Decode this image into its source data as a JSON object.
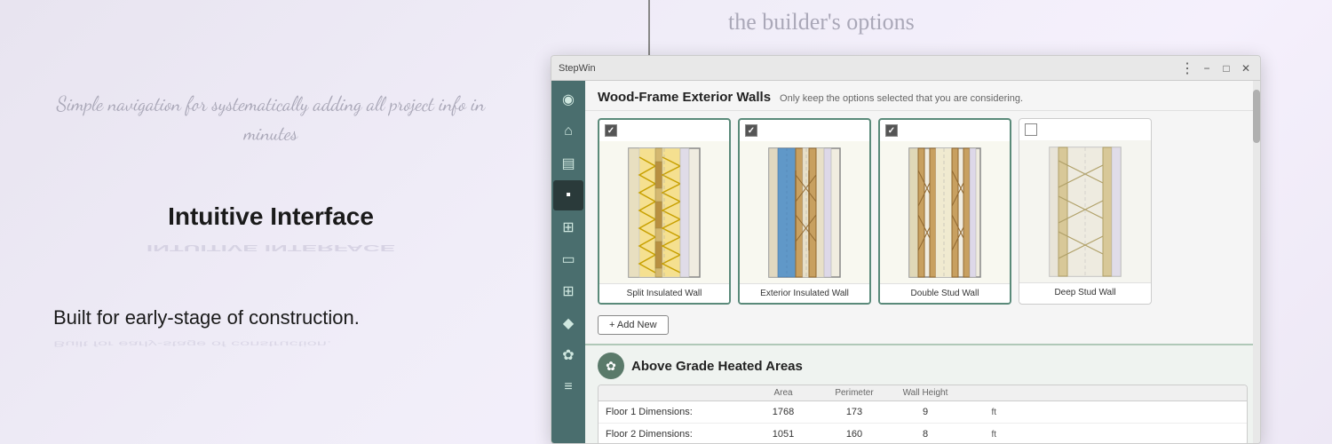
{
  "background": {
    "top_right_text": "the builder's options"
  },
  "left_panel": {
    "nav_text": "Simple navigation for\nsystematically adding all\nproject info in minutes",
    "intuitive_label": "Intuitive Interface",
    "intuitive_reflection": "INTUITIVE INTERFACE",
    "built_label": "Built for early-stage of construction.",
    "built_reflection": "Built for early-stage of construction."
  },
  "window": {
    "title": "StepWin",
    "controls": {
      "menu_dots": "⋮",
      "minimize": "−",
      "maximize": "□",
      "close": "✕"
    }
  },
  "sidebar": {
    "items": [
      {
        "id": "location-icon",
        "symbol": "◉",
        "active": false
      },
      {
        "id": "home-icon",
        "symbol": "⌂",
        "active": false
      },
      {
        "id": "stairs-icon",
        "symbol": "▤",
        "active": false
      },
      {
        "id": "wall-icon",
        "symbol": "▪",
        "active": true
      },
      {
        "id": "window-icon",
        "symbol": "⊞",
        "active": false
      },
      {
        "id": "door-icon",
        "symbol": "▭",
        "active": false
      },
      {
        "id": "grid-icon",
        "symbol": "⊞",
        "active": false
      },
      {
        "id": "drop-icon",
        "symbol": "◆",
        "active": false
      },
      {
        "id": "gear-icon",
        "symbol": "✿",
        "active": false
      },
      {
        "id": "list-icon",
        "symbol": "≡",
        "active": false
      }
    ]
  },
  "wood_frame_section": {
    "title": "Wood-Frame Exterior Walls",
    "subtitle": "Only keep the options selected that you are considering.",
    "cards": [
      {
        "id": "split-insulated",
        "label": "Split Insulated Wall",
        "checked": true,
        "selected": true
      },
      {
        "id": "exterior-insulated",
        "label": "Exterior Insulated Wall",
        "checked": true,
        "selected": true
      },
      {
        "id": "double-stud",
        "label": "Double Stud Wall",
        "checked": true,
        "selected": true
      },
      {
        "id": "deep-stud",
        "label": "Deep Stud Wall",
        "checked": false,
        "selected": false
      }
    ],
    "add_new_label": "+ Add New"
  },
  "above_grade_section": {
    "title": "Above Grade Heated Areas",
    "floor_table": {
      "columns": [
        "",
        "Area",
        "Perimeter",
        "Wall Height",
        ""
      ],
      "rows": [
        {
          "label": "Floor 1 Dimensions:",
          "area": "1768",
          "perimeter": "173",
          "wall_height": "9",
          "unit": "ft"
        },
        {
          "label": "Floor 2 Dimensions:",
          "area": "1051",
          "perimeter": "160",
          "wall_height": "8",
          "unit": "ft"
        }
      ]
    }
  }
}
